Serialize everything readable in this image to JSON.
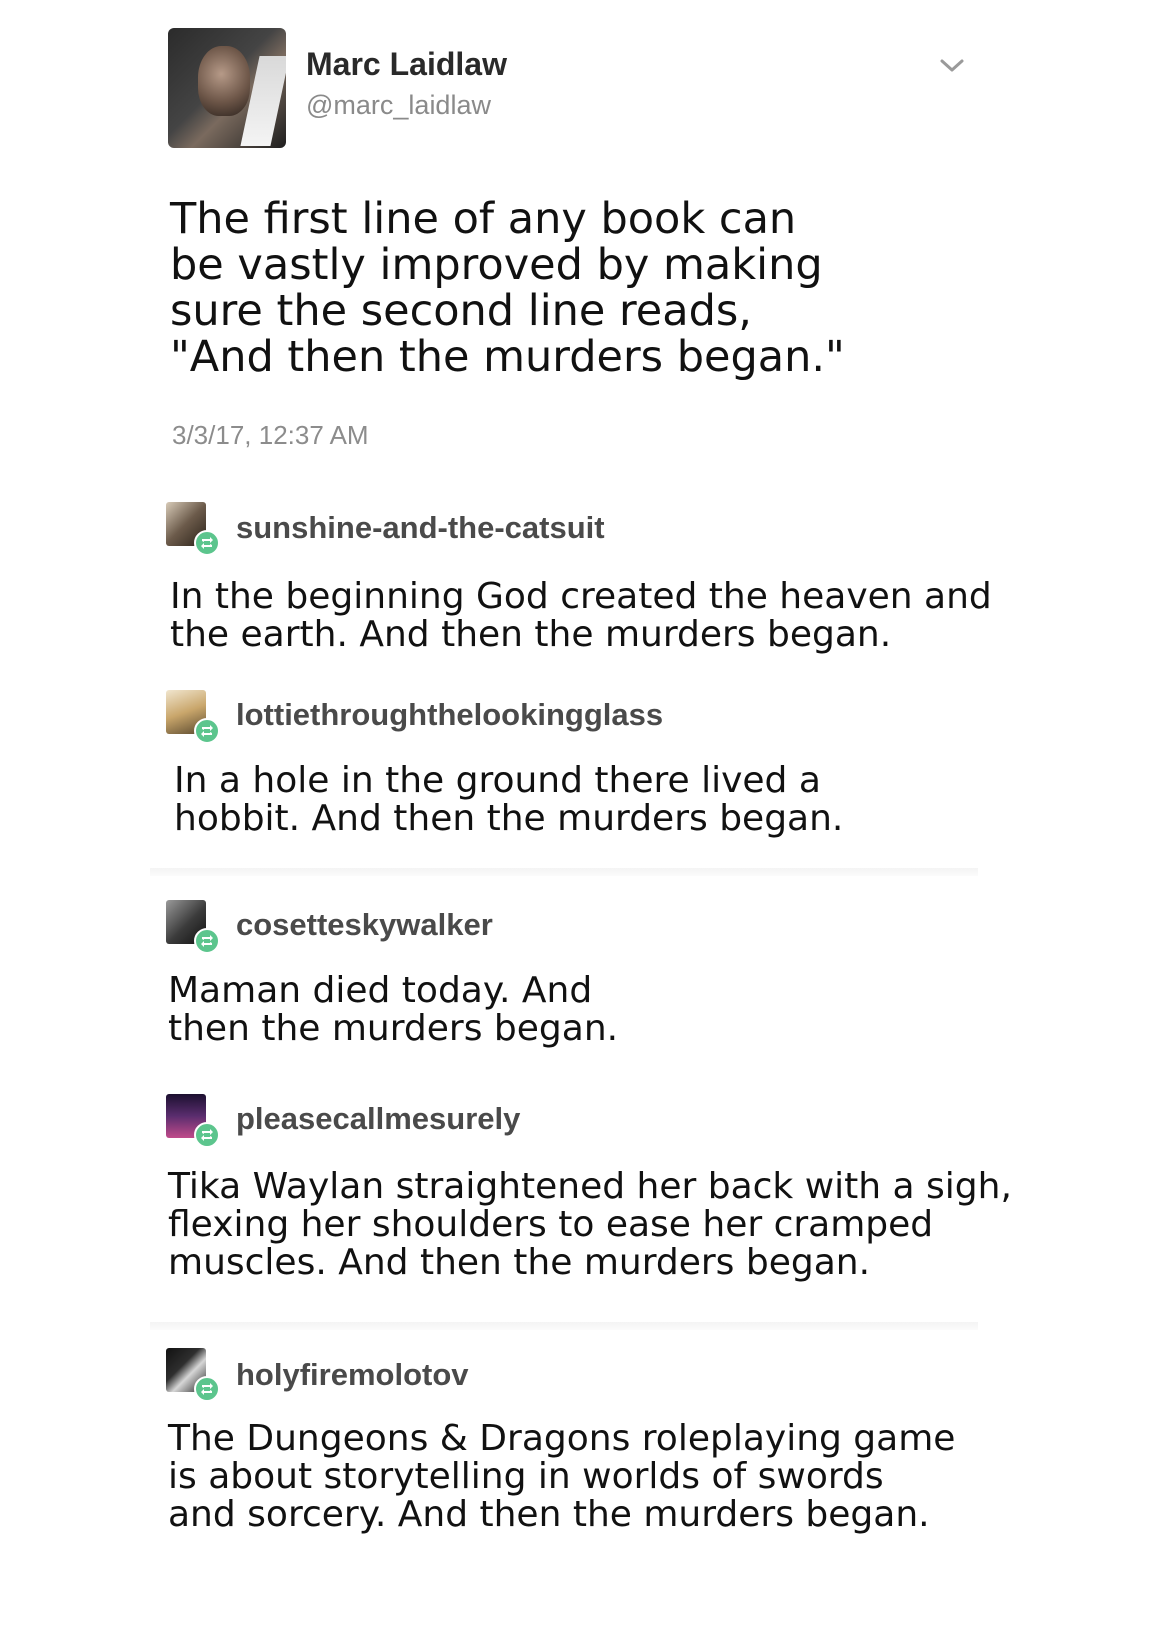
{
  "tweet": {
    "author_name": "Marc Laidlaw",
    "handle": "@marc_laidlaw",
    "text": "The first line of any book can\nbe vastly improved by making\nsure the second line reads,\n\"And then the murders began.\"",
    "timestamp": "3/3/17, 12:37 AM",
    "menu_icon": "chevron-down-icon"
  },
  "reblogs": [
    {
      "username": "sunshine-and-the-catsuit",
      "text": "In the beginning God created the heaven and\nthe earth. And then the murders began.",
      "avatar_color": "#6b5a4a"
    },
    {
      "username": "lottiethroughthelookingglass",
      "text": "In a hole in the ground there lived a\nhobbit. And then the murders began.",
      "avatar_color": "#c9a66b"
    },
    {
      "username": "cosetteskywalker",
      "text": "Maman died today. And\nthen the murders began.",
      "avatar_color": "#3a3a3a"
    },
    {
      "username": "pleasecallmesurely",
      "text": "Tika Waylan straightened her back with a sigh,\nflexing her shoulders to ease her cramped\nmuscles. And then the murders began.",
      "avatar_color": "#5a2d6e"
    },
    {
      "username": "holyfiremolotov",
      "text": "The Dungeons & Dragons roleplaying game\nis about storytelling in worlds of swords\nand sorcery. And then the murders began.",
      "avatar_color": "#2e2e2e"
    }
  ],
  "reblog_icon": "reblog-icon",
  "reblog_badge_color": "#5cc58d"
}
